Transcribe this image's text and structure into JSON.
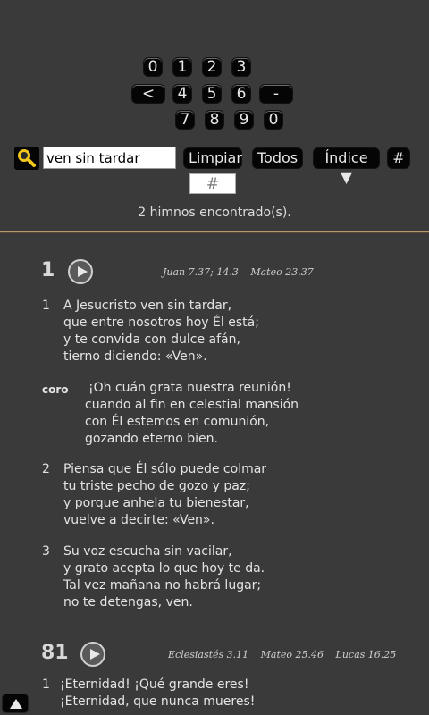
{
  "keypad": {
    "row1": [
      "0",
      "1",
      "2",
      "3"
    ],
    "row2": [
      "<",
      "4",
      "5",
      "6",
      "-"
    ],
    "row3": [
      "7",
      "8",
      "9",
      "0"
    ]
  },
  "search": {
    "value": "ven sin tardar",
    "placeholder": ""
  },
  "toolbar": {
    "clear_label": "Limpiar",
    "all_label": "Todos",
    "index_label": "Índice ▼",
    "hash_label": "#"
  },
  "hash_field": {
    "placeholder": "#"
  },
  "results_text": "2 himnos encontrado(s).",
  "icons": {
    "search": "search-icon",
    "play": "play-icon",
    "scroll_top": "scroll-up-icon"
  },
  "colors": {
    "background": "#3a3a3a",
    "divider": "#b89a6a",
    "button": "#050505"
  },
  "hymns": [
    {
      "number": "1",
      "refs": [
        "Juan 7.37; 14.3",
        "Mateo 23.37"
      ],
      "stanzas": [
        {
          "label": "1",
          "lines": [
            "A Jesucristo ven sin tardar,",
            "que entre nosotros hoy Él está;",
            "y te convida con dulce afán,",
            "tierno diciendo: «Ven»."
          ]
        },
        {
          "label": "coro",
          "lines": [
            "¡Oh cuán grata nuestra reunión!",
            "cuando al fin en celestial mansión",
            "con Él estemos en comunión,",
            "gozando eterno bien."
          ]
        },
        {
          "label": "2",
          "lines": [
            "Piensa que Él sólo puede colmar",
            "tu triste pecho de gozo y paz;",
            "y porque anhela tu bienestar,",
            "vuelve a decirte: «Ven»."
          ]
        },
        {
          "label": "3",
          "lines": [
            "Su voz escucha sin vacilar,",
            "y grato acepta lo que hoy te da.",
            "Tal vez mañana no habrá lugar;",
            "no te detengas, ven."
          ]
        }
      ]
    },
    {
      "number": "81",
      "refs": [
        "Eclesiastés 3.11",
        "Mateo 25.46",
        "Lucas 16.25"
      ],
      "stanzas": [
        {
          "label": "1",
          "lines": [
            "¡Eternidad!  ¡Qué grande eres!",
            "¡Eternidad, que nunca mueres!"
          ]
        }
      ]
    }
  ]
}
